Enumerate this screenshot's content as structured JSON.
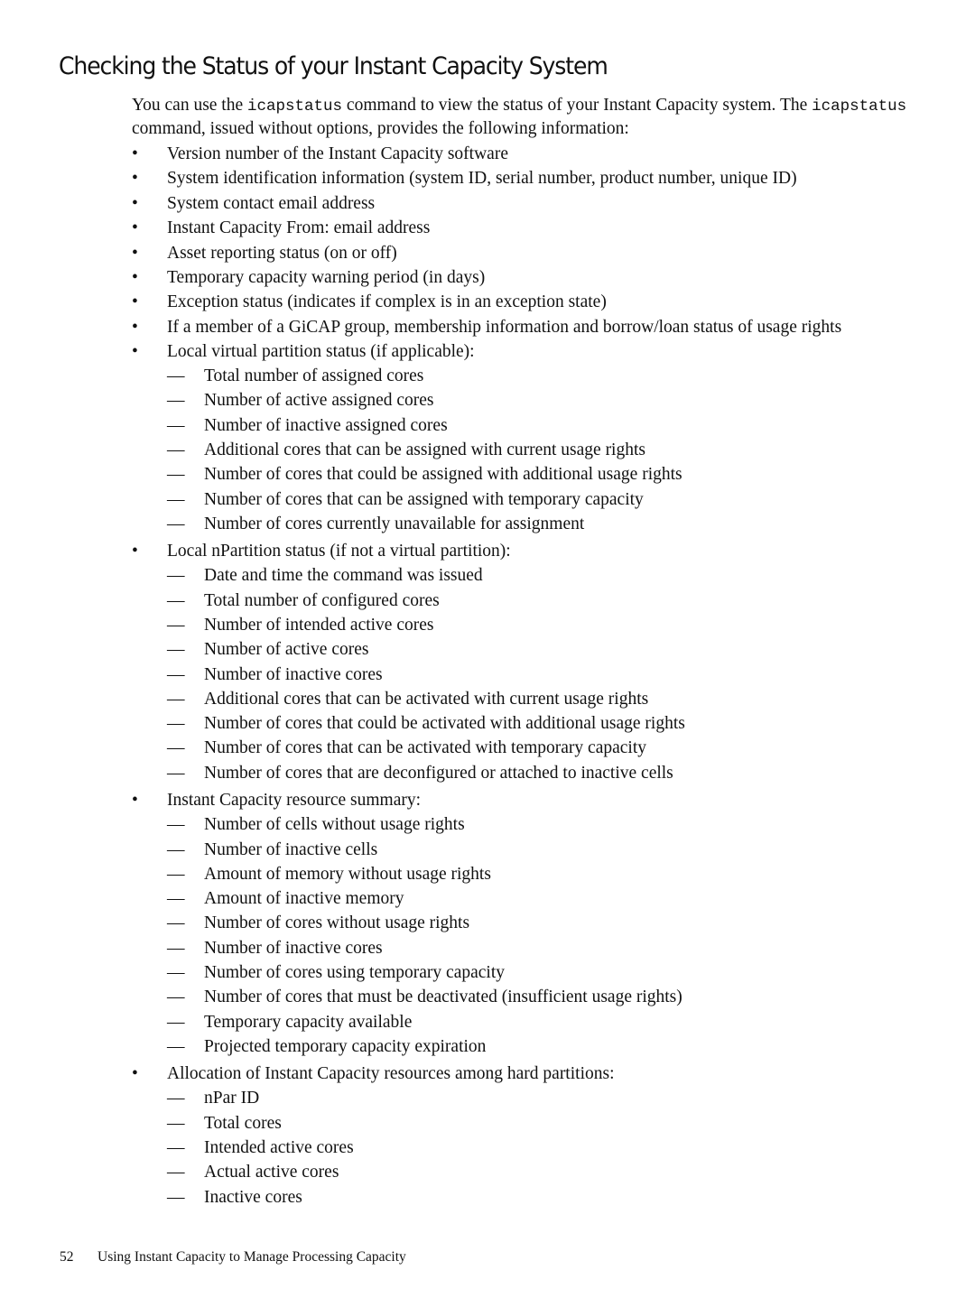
{
  "heading": "Checking the Status of your Instant Capacity System",
  "intro": {
    "part1": "You can use the ",
    "cmd1": "icapstatus",
    "part2": " command to view the status of your Instant Capacity system. The ",
    "cmd2": "icapstatus",
    "part3": " command, issued without options, provides the following information:"
  },
  "bullet_glyph": "•",
  "dash_glyph": "—",
  "items": [
    {
      "text": "Version number of the Instant Capacity software",
      "sub": []
    },
    {
      "text": "System identification information (system ID, serial number, product number, unique ID)",
      "sub": []
    },
    {
      "text": "System contact email address",
      "sub": []
    },
    {
      "text": "Instant Capacity From: email address",
      "sub": []
    },
    {
      "text": "Asset reporting status (on or off)",
      "sub": []
    },
    {
      "text": "Temporary capacity warning period (in days)",
      "sub": []
    },
    {
      "text": "Exception status (indicates if complex is in an exception state)",
      "sub": []
    },
    {
      "text": "If a member of a GiCAP group, membership information and borrow/loan status of usage rights",
      "sub": []
    },
    {
      "text": "Local virtual partition status (if applicable):",
      "sub": [
        "Total number of assigned cores",
        "Number of active assigned cores",
        "Number of inactive assigned cores",
        "Additional cores that can be assigned with current usage rights",
        "Number of cores that could be assigned with additional usage rights",
        "Number of cores that can be assigned with temporary capacity",
        "Number of cores currently unavailable for assignment"
      ]
    },
    {
      "text": "Local nPartition status (if not a virtual partition):",
      "sub": [
        "Date and time the command was issued",
        "Total number of configured cores",
        "Number of intended active cores",
        "Number of active cores",
        "Number of inactive cores",
        "Additional cores that can be activated with current usage rights",
        "Number of cores that could be activated with additional usage rights",
        "Number of cores that can be activated with temporary capacity",
        "Number of cores that are deconfigured or attached to inactive cells"
      ]
    },
    {
      "text": "Instant Capacity resource summary:",
      "sub": [
        "Number of cells without usage rights",
        "Number of inactive cells",
        "Amount of memory without usage rights",
        "Amount of inactive memory",
        "Number of cores without usage rights",
        "Number of inactive cores",
        "Number of cores using temporary capacity",
        "Number of cores that must be deactivated (insufficient usage rights)",
        "Temporary capacity available",
        "Projected temporary capacity expiration"
      ]
    },
    {
      "text": "Allocation of Instant Capacity resources among hard partitions:",
      "sub": [
        "nPar ID",
        "Total cores",
        "Intended active cores",
        "Actual active cores",
        "Inactive cores"
      ]
    }
  ],
  "footer": {
    "page_number": "52",
    "chapter_title": "Using Instant Capacity to Manage Processing Capacity"
  }
}
